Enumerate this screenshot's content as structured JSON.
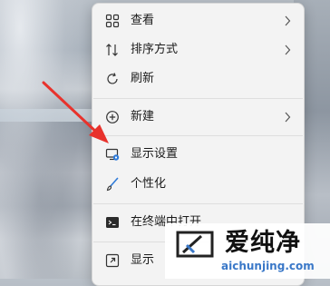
{
  "menu": {
    "items": [
      {
        "label": "查看",
        "icon": "grid-view-icon",
        "submenu": true
      },
      {
        "label": "排序方式",
        "icon": "sort-arrows-icon",
        "submenu": true
      },
      {
        "label": "刷新",
        "icon": "refresh-icon",
        "submenu": false
      },
      {
        "label": "新建",
        "icon": "add-circle-icon",
        "submenu": true
      },
      {
        "label": "显示设置",
        "icon": "display-settings-icon",
        "submenu": false
      },
      {
        "label": "个性化",
        "icon": "brush-icon",
        "submenu": false
      },
      {
        "label": "在终端中打开",
        "icon": "terminal-icon",
        "submenu": false
      },
      {
        "label": "显示",
        "icon": "show-more-icon",
        "submenu": false
      }
    ]
  },
  "annotation": {
    "arrow_color": "#e8322c"
  },
  "watermark": {
    "chinese_text": "爱纯净",
    "url": "aichunjing.com"
  },
  "colors": {
    "menu_bg": "#f3f3f3",
    "text": "#1a1a1a",
    "accent_blue": "#2f7bd8"
  }
}
